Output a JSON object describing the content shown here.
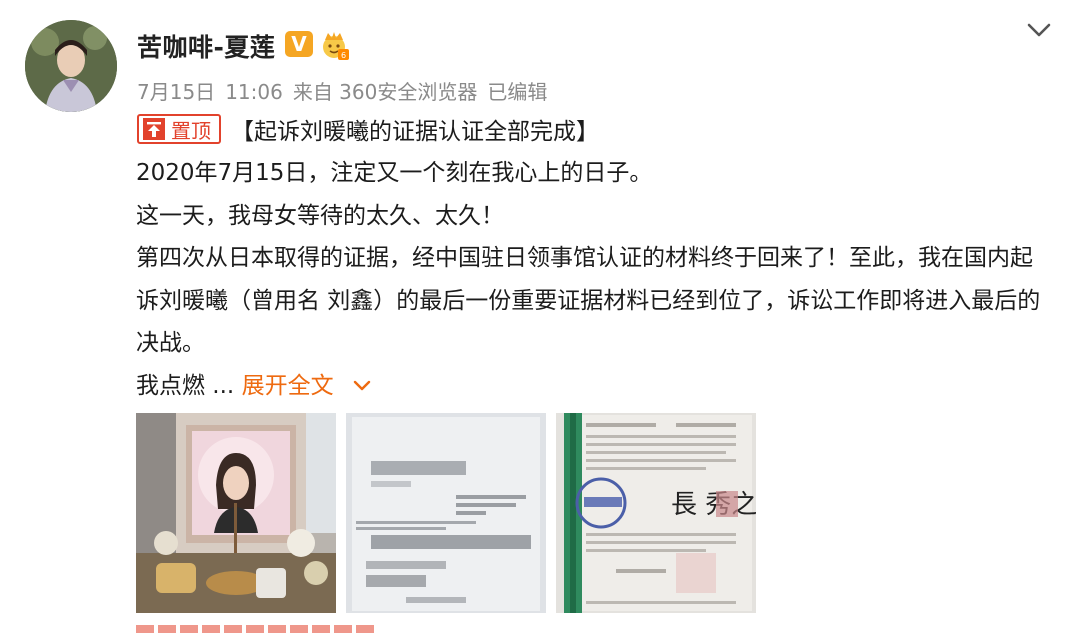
{
  "post": {
    "username": "苦咖啡-夏莲",
    "verified_badge": "V",
    "date": "7月15日",
    "time": "11:06",
    "source": "来自 360安全浏览器",
    "edited": "已编辑",
    "pin_label": "置顶",
    "title": "【起诉刘暖曦的证据认证全部完成】",
    "paragraphs": [
      "2020年7月15日，注定又一个刻在我心上的日子。",
      "这一天，我母女等待的太久、太久！",
      "第四次从日本取得的证据，经中国驻日领事馆认证的材料终于回来了！至此，我在国内起诉刘暖曦（曾用名 刘鑫）的最后一份重要证据材料已经到位了，诉讼工作即将进入最后的决战。"
    ],
    "truncated_text": "我点燃 ...",
    "expand_label": "展开全文"
  },
  "thumbnails": [
    {
      "kind": "memorial-photo-icon"
    },
    {
      "kind": "document-photo-icon"
    },
    {
      "kind": "notarized-document-icon",
      "seal_text": "長 秀之"
    }
  ],
  "colors": {
    "accent_red": "#e2422c",
    "expand_orange": "#ee6a10",
    "meta_gray": "#8a8a8a",
    "vip_gold": "#f5a623"
  }
}
